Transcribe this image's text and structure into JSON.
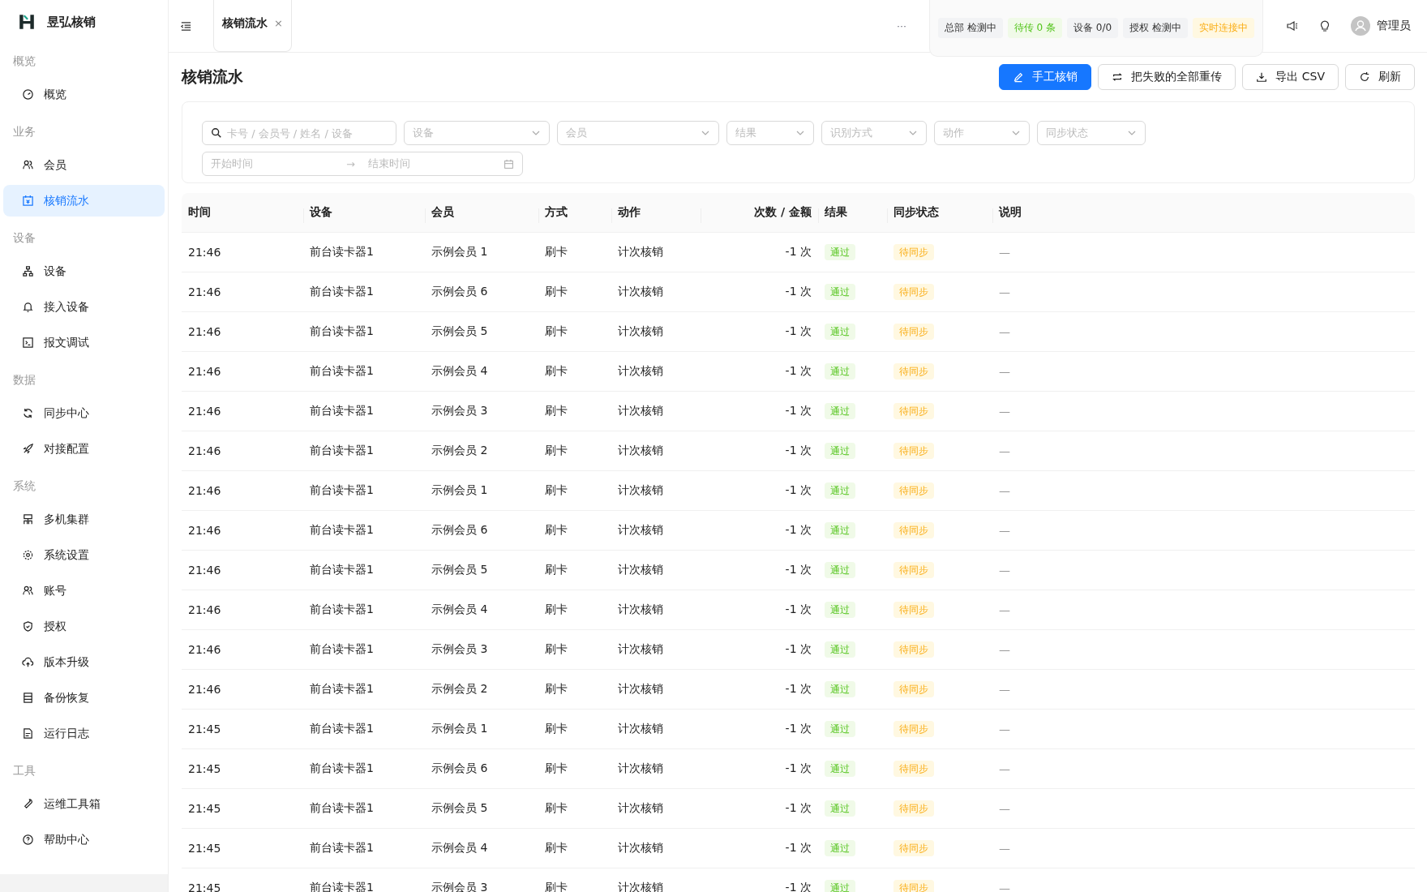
{
  "brand": {
    "name": "昱弘核销"
  },
  "sidebar": {
    "groups": [
      {
        "title": "概览",
        "items": [
          {
            "label": "概览",
            "selected": false
          }
        ]
      },
      {
        "title": "业务",
        "items": [
          {
            "label": "会员",
            "selected": false
          },
          {
            "label": "核销流水",
            "selected": true
          }
        ]
      },
      {
        "title": "设备",
        "items": [
          {
            "label": "设备",
            "selected": false
          },
          {
            "label": "接入设备",
            "selected": false
          },
          {
            "label": "报文调试",
            "selected": false
          }
        ]
      },
      {
        "title": "数据",
        "items": [
          {
            "label": "同步中心",
            "selected": false
          },
          {
            "label": "对接配置",
            "selected": false
          }
        ]
      },
      {
        "title": "系统",
        "items": [
          {
            "label": "多机集群",
            "selected": false
          },
          {
            "label": "系统设置",
            "selected": false
          },
          {
            "label": "账号",
            "selected": false
          },
          {
            "label": "授权",
            "selected": false
          },
          {
            "label": "版本升级",
            "selected": false
          },
          {
            "label": "备份恢复",
            "selected": false
          },
          {
            "label": "运行日志",
            "selected": false
          }
        ]
      },
      {
        "title": "工具",
        "items": [
          {
            "label": "运维工具箱",
            "selected": false
          },
          {
            "label": "帮助中心",
            "selected": false
          }
        ]
      }
    ]
  },
  "tabs": [
    {
      "label": "核销流水",
      "close": "×",
      "selected": true
    }
  ],
  "more": "···",
  "status_chips": [
    {
      "text": "总部 检测中",
      "color": "#f2f3f5"
    },
    {
      "text": "待传 0 条",
      "color": "#f0fae8"
    },
    {
      "text": "设备 0/0",
      "color": "#f2f3f5"
    },
    {
      "text": "授权 检测中",
      "color": "#f2f3f5"
    },
    {
      "text": "实时连接中",
      "color": "#fff8e1"
    }
  ],
  "user": {
    "name": "管理员"
  },
  "page_title": "核销流水",
  "actions": [
    {
      "label": "手工核销",
      "kind": "primary"
    },
    {
      "label": "把失败的全部重传",
      "kind": "default"
    },
    {
      "label": "导出 CSV",
      "kind": "default"
    },
    {
      "label": "刷新",
      "kind": "default"
    }
  ],
  "filters": {
    "search": {
      "placeholder": "卡号 / 会员号 / 姓名 / 设备"
    },
    "selects": [
      {
        "placeholder": "设备"
      },
      {
        "placeholder": "会员"
      },
      {
        "placeholder": "结果"
      },
      {
        "placeholder": "识别方式"
      },
      {
        "placeholder": "动作"
      },
      {
        "placeholder": "同步状态"
      }
    ],
    "date_range": {
      "start_placeholder": "开始时间",
      "separator": "→",
      "end_placeholder": "结束时间"
    }
  },
  "table": {
    "columns": [
      "时间",
      "设备",
      "会员",
      "方式",
      "动作",
      "次数 / 金额",
      "结果",
      "同步状态",
      "说明"
    ],
    "rows": [
      {
        "time": "21:46",
        "device": "前台读卡器1",
        "member": "示例会员 1",
        "method": "刷卡",
        "action": "计次核销",
        "amount": "-1 次",
        "result": "通过",
        "sync": "待同步",
        "note": "—"
      },
      {
        "time": "21:46",
        "device": "前台读卡器1",
        "member": "示例会员 6",
        "method": "刷卡",
        "action": "计次核销",
        "amount": "-1 次",
        "result": "通过",
        "sync": "待同步",
        "note": "—"
      },
      {
        "time": "21:46",
        "device": "前台读卡器1",
        "member": "示例会员 5",
        "method": "刷卡",
        "action": "计次核销",
        "amount": "-1 次",
        "result": "通过",
        "sync": "待同步",
        "note": "—"
      },
      {
        "time": "21:46",
        "device": "前台读卡器1",
        "member": "示例会员 4",
        "method": "刷卡",
        "action": "计次核销",
        "amount": "-1 次",
        "result": "通过",
        "sync": "待同步",
        "note": "—"
      },
      {
        "time": "21:46",
        "device": "前台读卡器1",
        "member": "示例会员 3",
        "method": "刷卡",
        "action": "计次核销",
        "amount": "-1 次",
        "result": "通过",
        "sync": "待同步",
        "note": "—"
      },
      {
        "time": "21:46",
        "device": "前台读卡器1",
        "member": "示例会员 2",
        "method": "刷卡",
        "action": "计次核销",
        "amount": "-1 次",
        "result": "通过",
        "sync": "待同步",
        "note": "—"
      },
      {
        "time": "21:46",
        "device": "前台读卡器1",
        "member": "示例会员 1",
        "method": "刷卡",
        "action": "计次核销",
        "amount": "-1 次",
        "result": "通过",
        "sync": "待同步",
        "note": "—"
      },
      {
        "time": "21:46",
        "device": "前台读卡器1",
        "member": "示例会员 6",
        "method": "刷卡",
        "action": "计次核销",
        "amount": "-1 次",
        "result": "通过",
        "sync": "待同步",
        "note": "—"
      },
      {
        "time": "21:46",
        "device": "前台读卡器1",
        "member": "示例会员 5",
        "method": "刷卡",
        "action": "计次核销",
        "amount": "-1 次",
        "result": "通过",
        "sync": "待同步",
        "note": "—"
      },
      {
        "time": "21:46",
        "device": "前台读卡器1",
        "member": "示例会员 4",
        "method": "刷卡",
        "action": "计次核销",
        "amount": "-1 次",
        "result": "通过",
        "sync": "待同步",
        "note": "—"
      },
      {
        "time": "21:46",
        "device": "前台读卡器1",
        "member": "示例会员 3",
        "method": "刷卡",
        "action": "计次核销",
        "amount": "-1 次",
        "result": "通过",
        "sync": "待同步",
        "note": "—"
      },
      {
        "time": "21:46",
        "device": "前台读卡器1",
        "member": "示例会员 2",
        "method": "刷卡",
        "action": "计次核销",
        "amount": "-1 次",
        "result": "通过",
        "sync": "待同步",
        "note": "—"
      },
      {
        "time": "21:45",
        "device": "前台读卡器1",
        "member": "示例会员 1",
        "method": "刷卡",
        "action": "计次核销",
        "amount": "-1 次",
        "result": "通过",
        "sync": "待同步",
        "note": "—"
      },
      {
        "time": "21:45",
        "device": "前台读卡器1",
        "member": "示例会员 6",
        "method": "刷卡",
        "action": "计次核销",
        "amount": "-1 次",
        "result": "通过",
        "sync": "待同步",
        "note": "—"
      },
      {
        "time": "21:45",
        "device": "前台读卡器1",
        "member": "示例会员 5",
        "method": "刷卡",
        "action": "计次核销",
        "amount": "-1 次",
        "result": "通过",
        "sync": "待同步",
        "note": "—"
      },
      {
        "time": "21:45",
        "device": "前台读卡器1",
        "member": "示例会员 4",
        "method": "刷卡",
        "action": "计次核销",
        "amount": "-1 次",
        "result": "通过",
        "sync": "待同步",
        "note": "—"
      },
      {
        "time": "21:45",
        "device": "前台读卡器1",
        "member": "示例会员 3",
        "method": "刷卡",
        "action": "计次核销",
        "amount": "-1 次",
        "result": "通过",
        "sync": "待同步",
        "note": "—"
      }
    ]
  }
}
